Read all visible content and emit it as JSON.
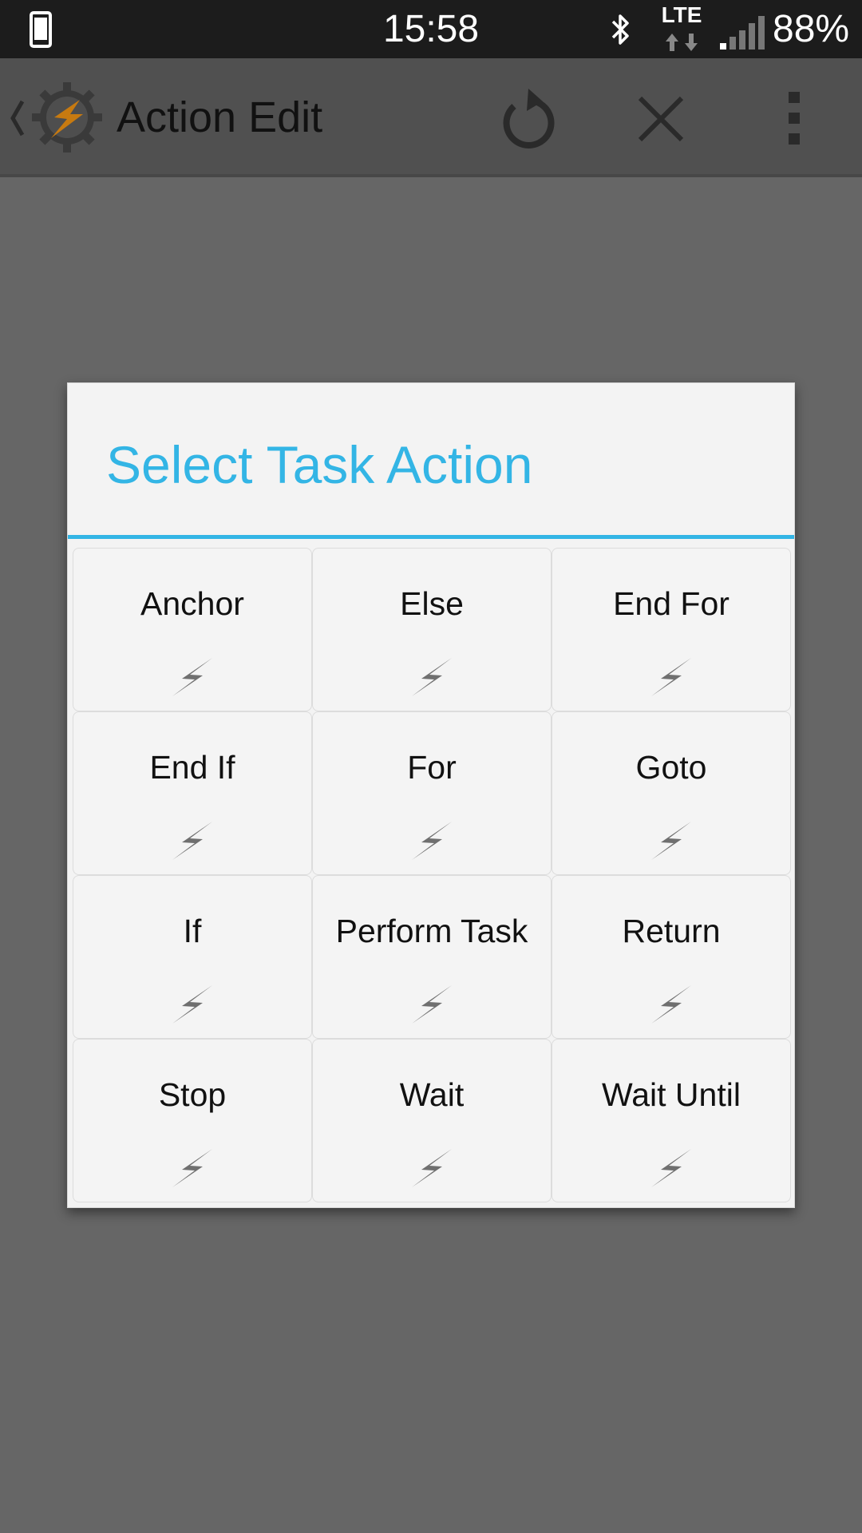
{
  "status_bar": {
    "time": "15:58",
    "network": "LTE",
    "battery": "88%",
    "icons": [
      "phone-icon",
      "bluetooth-icon",
      "lte-icon",
      "signal-icon"
    ]
  },
  "action_bar": {
    "title": "Action Edit",
    "icons": [
      "back-chevron-icon",
      "tasker-logo-icon",
      "undo-icon",
      "close-icon",
      "overflow-menu-icon"
    ]
  },
  "dialog": {
    "title": "Select Task Action",
    "items": [
      {
        "label": "Anchor"
      },
      {
        "label": "Else"
      },
      {
        "label": "End For"
      },
      {
        "label": "End If"
      },
      {
        "label": "For"
      },
      {
        "label": "Goto"
      },
      {
        "label": "If"
      },
      {
        "label": "Perform Task"
      },
      {
        "label": "Return"
      },
      {
        "label": "Stop"
      },
      {
        "label": "Wait"
      },
      {
        "label": "Wait Until"
      }
    ],
    "item_icon": "lightning-bolt-icon"
  },
  "colors": {
    "accent": "#33b5e5",
    "scrim": "#666666",
    "dialog_bg": "#f3f3f3",
    "status_bar": "#1c1c1c"
  }
}
